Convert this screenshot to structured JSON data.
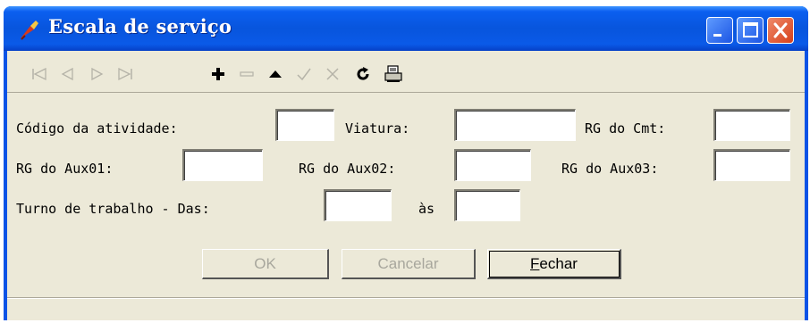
{
  "window": {
    "title": "Escala de serviço"
  },
  "toolbar": {
    "buttons": [
      {
        "icon": "first-record-icon",
        "enabled": false
      },
      {
        "icon": "prior-record-icon",
        "enabled": false
      },
      {
        "icon": "next-record-icon",
        "enabled": false
      },
      {
        "icon": "last-record-icon",
        "enabled": false
      },
      {
        "icon": "insert-icon",
        "enabled": true
      },
      {
        "icon": "delete-icon",
        "enabled": false
      },
      {
        "icon": "edit-icon",
        "enabled": true
      },
      {
        "icon": "post-icon",
        "enabled": false
      },
      {
        "icon": "cancel-icon",
        "enabled": false
      },
      {
        "icon": "refresh-icon",
        "enabled": true
      },
      {
        "icon": "print-icon",
        "enabled": true
      }
    ]
  },
  "form": {
    "codigo_label": "Código da atividade:",
    "codigo_value": "",
    "viatura_label": "Viatura:",
    "viatura_value": "",
    "rg_cmt_label": "RG do Cmt:",
    "rg_cmt_value": "",
    "rg_aux01_label": "RG do Aux01:",
    "rg_aux01_value": "",
    "rg_aux02_label": "RG do Aux02:",
    "rg_aux02_value": "",
    "rg_aux03_label": "RG do Aux03:",
    "rg_aux03_value": "",
    "turno_label": "Turno de trabalho - Das:",
    "turno_das_value": "",
    "as_label": "às",
    "turno_as_value": ""
  },
  "buttons": {
    "ok_label": "OK",
    "cancelar_label": "Cancelar",
    "fechar_label": "Fechar"
  },
  "status": {
    "text": ""
  },
  "colors": {
    "titlebar": "#0a53e6",
    "client": "#ece9d8",
    "close_button": "#d7401a"
  }
}
